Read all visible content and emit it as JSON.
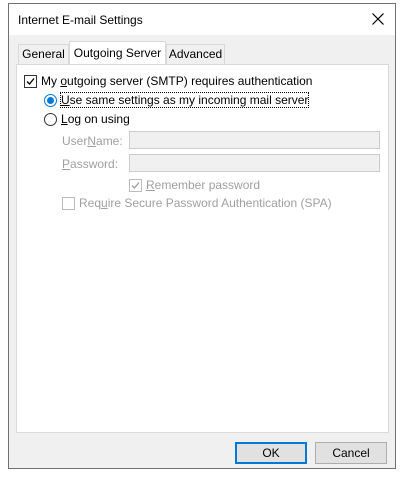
{
  "window": {
    "title": "Internet E-mail Settings"
  },
  "tabs": [
    {
      "label": "General",
      "active": false
    },
    {
      "label": "Outgoing Server",
      "active": true
    },
    {
      "label": "Advanced",
      "active": false
    }
  ],
  "smtp_auth": {
    "pre": "My ",
    "mnemonic": "o",
    "post": "utgoing server (SMTP) requires authentication",
    "checked": true
  },
  "radio_same": {
    "mnemonic": "U",
    "post": "se same settings as my incoming mail server",
    "selected": true
  },
  "radio_logon": {
    "mnemonic": "L",
    "post": "og on using",
    "selected": false
  },
  "username": {
    "pre": "User ",
    "mnemonic": "N",
    "post": "ame:",
    "value": ""
  },
  "password": {
    "mnemonic": "P",
    "post": "assword:",
    "value": ""
  },
  "remember": {
    "mnemonic": "R",
    "post": "emember password",
    "checked": true
  },
  "spa": {
    "pre": "Req",
    "mnemonic": "u",
    "post": "ire Secure Password Authentication (SPA)",
    "checked": false
  },
  "buttons": {
    "ok": "OK",
    "cancel": "Cancel"
  },
  "colors": {
    "accent": "#0078d7",
    "disabled_text": "#a0a0a0"
  }
}
